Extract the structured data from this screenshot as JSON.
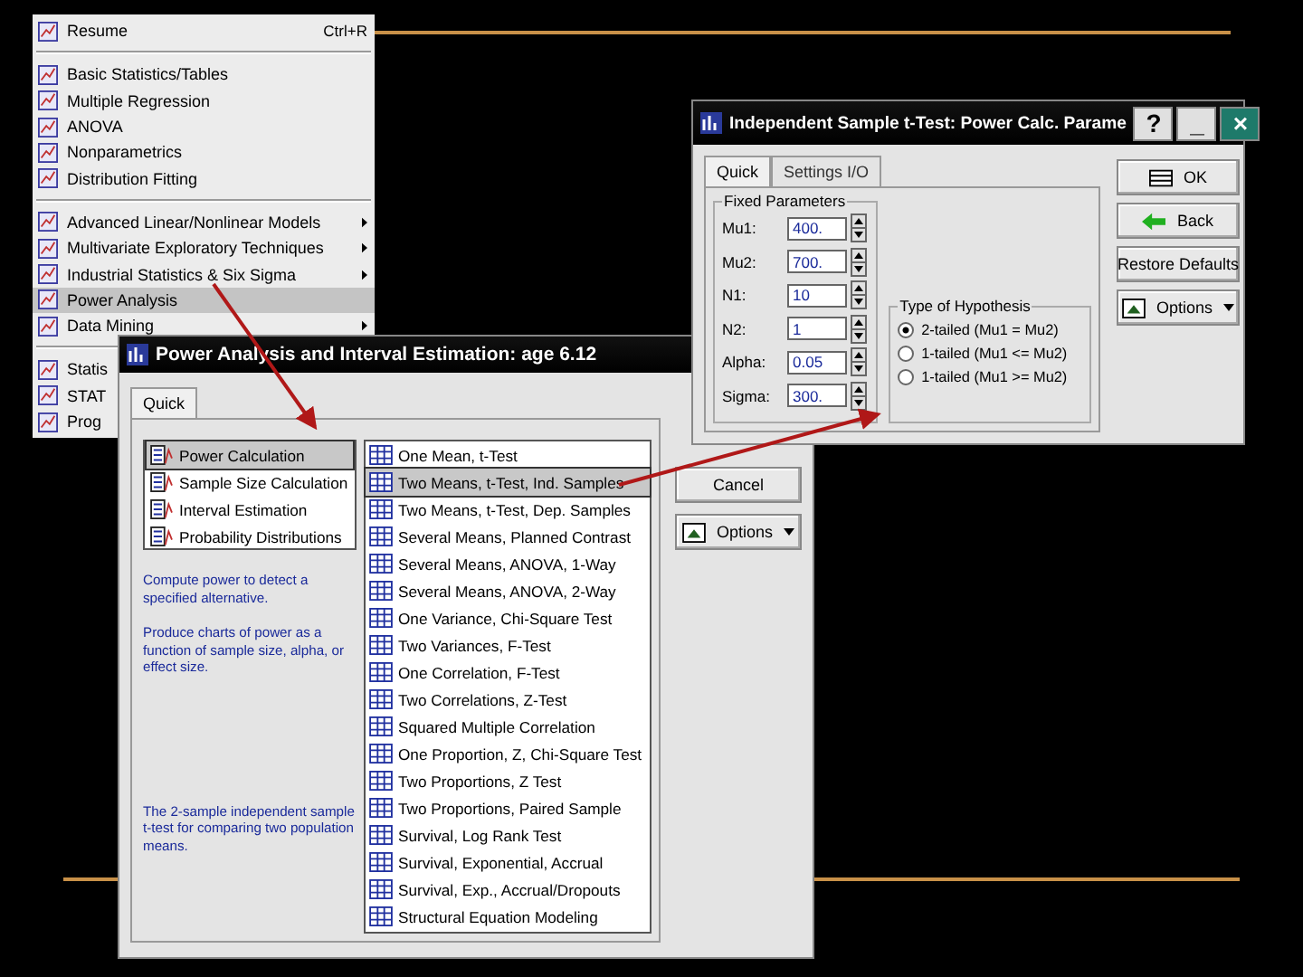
{
  "menu": {
    "items": [
      {
        "kind": "item",
        "label": "Resume",
        "shortcut": "Ctrl+R",
        "selected": false,
        "submenu": false
      },
      {
        "kind": "separator"
      },
      {
        "kind": "item",
        "label": "Basic Statistics/Tables",
        "selected": false,
        "submenu": false
      },
      {
        "kind": "item",
        "label": "Multiple Regression",
        "selected": false,
        "submenu": false
      },
      {
        "kind": "item",
        "label": "ANOVA",
        "selected": false,
        "submenu": false
      },
      {
        "kind": "item",
        "label": "Nonparametrics",
        "selected": false,
        "submenu": false
      },
      {
        "kind": "item",
        "label": "Distribution Fitting",
        "selected": false,
        "submenu": false
      },
      {
        "kind": "separator"
      },
      {
        "kind": "item",
        "label": "Advanced Linear/Nonlinear Models",
        "selected": false,
        "submenu": true
      },
      {
        "kind": "item",
        "label": "Multivariate Exploratory Techniques",
        "selected": false,
        "submenu": true
      },
      {
        "kind": "item",
        "label": "Industrial Statistics & Six Sigma",
        "selected": false,
        "submenu": true
      },
      {
        "kind": "item",
        "label": "Power Analysis",
        "selected": true,
        "submenu": false
      },
      {
        "kind": "item",
        "label": "Data Mining",
        "selected": false,
        "submenu": true
      },
      {
        "kind": "separator"
      },
      {
        "kind": "item",
        "label": "Statis",
        "selected": false,
        "submenu": false
      },
      {
        "kind": "item",
        "label": "STAT",
        "selected": false,
        "submenu": false
      },
      {
        "kind": "item",
        "label": "Prog",
        "selected": false,
        "submenu": false
      }
    ]
  },
  "analysis_dialog": {
    "title": "Power Analysis and Interval Estimation: age 6.12",
    "tabs": [
      {
        "label": "Quick",
        "selected": true
      }
    ],
    "modes": [
      {
        "label": "Power Calculation",
        "selected": true
      },
      {
        "label": "Sample Size Calculation",
        "selected": false
      },
      {
        "label": "Interval Estimation",
        "selected": false
      },
      {
        "label": "Probability Distributions",
        "selected": false
      }
    ],
    "descriptions": [
      "Compute power to detect a specified alternative.",
      "Produce charts of power as a function of sample size, alpha, or effect size.",
      "The 2-sample independent sample t-test for comparing two population means."
    ],
    "tests": [
      {
        "label": "One Mean, t-Test",
        "selected": false
      },
      {
        "label": "Two Means, t-Test, Ind. Samples",
        "selected": true
      },
      {
        "label": "Two Means, t-Test, Dep. Samples",
        "selected": false
      },
      {
        "label": "Several Means, Planned Contrast",
        "selected": false
      },
      {
        "label": "Several Means, ANOVA, 1-Way",
        "selected": false
      },
      {
        "label": "Several Means, ANOVA, 2-Way",
        "selected": false
      },
      {
        "label": "One Variance, Chi-Square Test",
        "selected": false
      },
      {
        "label": "Two Variances, F-Test",
        "selected": false
      },
      {
        "label": "One Correlation, F-Test",
        "selected": false
      },
      {
        "label": "Two Correlations, Z-Test",
        "selected": false
      },
      {
        "label": "Squared Multiple Correlation",
        "selected": false
      },
      {
        "label": "One Proportion, Z, Chi-Square Test",
        "selected": false
      },
      {
        "label": "Two Proportions, Z Test",
        "selected": false
      },
      {
        "label": "Two Proportions, Paired Sample",
        "selected": false
      },
      {
        "label": "Survival, Log Rank Test",
        "selected": false
      },
      {
        "label": "Survival, Exponential, Accrual",
        "selected": false
      },
      {
        "label": "Survival, Exp., Accrual/Dropouts",
        "selected": false
      },
      {
        "label": "Structural Equation Modeling",
        "selected": false
      }
    ],
    "buttons": [
      {
        "label": "Cancel",
        "kind": "plain"
      },
      {
        "label": "Options",
        "kind": "dropdown"
      }
    ]
  },
  "ttest_dialog": {
    "title": "Independent Sample t-Test: Power Calc. Parame",
    "controls": [
      "?",
      "_",
      "×"
    ],
    "tabs": [
      {
        "label": "Quick",
        "selected": true
      },
      {
        "label": "Settings I/O",
        "selected": false
      }
    ],
    "fixed_parameters": {
      "title": "Fixed Parameters",
      "fields": [
        {
          "label": "Mu1:",
          "value": "400."
        },
        {
          "label": "Mu2:",
          "value": "700."
        },
        {
          "label": "N1:",
          "value": "10"
        },
        {
          "label": "N2:",
          "value": "1"
        },
        {
          "label": "Alpha:",
          "value": "0.05"
        },
        {
          "label": "Sigma:",
          "value": "300."
        }
      ]
    },
    "hypothesis": {
      "title": "Type of Hypothesis",
      "options": [
        {
          "label": "2-tailed (Mu1 = Mu2)",
          "selected": true
        },
        {
          "label": "1-tailed (Mu1 <= Mu2)",
          "selected": false
        },
        {
          "label": "1-tailed (Mu1 >= Mu2)",
          "selected": false
        }
      ]
    },
    "buttons": [
      {
        "label": "OK",
        "kind": "ok"
      },
      {
        "label": "Back",
        "kind": "back"
      },
      {
        "label": "Restore Defaults",
        "kind": "plain"
      },
      {
        "label": "Options",
        "kind": "dropdown"
      }
    ]
  }
}
